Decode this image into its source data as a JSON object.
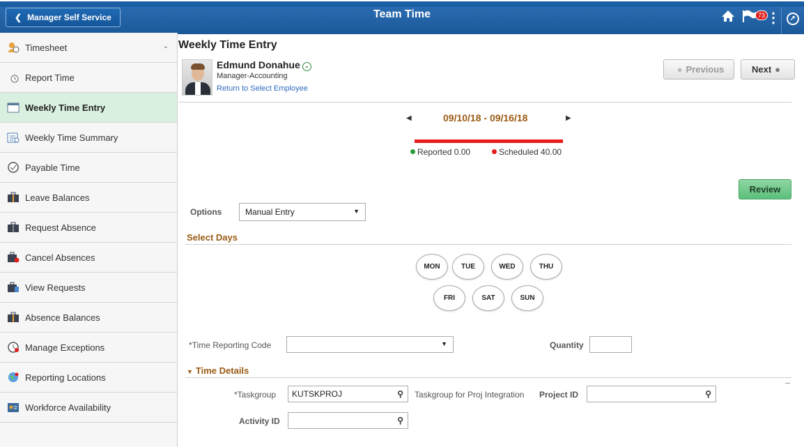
{
  "header": {
    "back_label": "Manager Self Service",
    "title": "Team Time",
    "notification_count": "73"
  },
  "sidebar": {
    "items": [
      {
        "label": "Timesheet",
        "icon": "timesheet-icon"
      },
      {
        "label": "Report Time",
        "icon": "clock-icon"
      },
      {
        "label": "Weekly Time Entry",
        "icon": "calendar-entry-icon"
      },
      {
        "label": "Weekly Time Summary",
        "icon": "calendar-summary-icon"
      },
      {
        "label": "Payable Time",
        "icon": "money-clock-icon"
      },
      {
        "label": "Leave Balances",
        "icon": "suitcase-icon"
      },
      {
        "label": "Request Absence",
        "icon": "suitcase-icon"
      },
      {
        "label": "Cancel Absences",
        "icon": "suitcase-cancel-icon"
      },
      {
        "label": "View Requests",
        "icon": "suitcase-view-icon"
      },
      {
        "label": "Absence Balances",
        "icon": "suitcase-icon"
      },
      {
        "label": "Manage Exceptions",
        "icon": "alert-clock-icon"
      },
      {
        "label": "Reporting Locations",
        "icon": "globe-icon"
      },
      {
        "label": "Workforce Availability",
        "icon": "availability-icon"
      }
    ]
  },
  "main": {
    "page_title": "Weekly Time Entry",
    "employee": {
      "name": "Edmund Donahue",
      "title": "Manager-Accounting",
      "return_link": "Return to Select Employee"
    },
    "previous_label": "Previous",
    "next_label": "Next",
    "week_range": "09/10/18 - 09/16/18",
    "reported": "Reported 0.00",
    "scheduled": "Scheduled 40.00",
    "review_label": "Review",
    "options_label": "Options",
    "options_value": "Manual Entry",
    "select_days_label": "Select Days",
    "days_row1": [
      "MON",
      "TUE",
      "WED",
      "THU"
    ],
    "days_row2": [
      "FRI",
      "SAT",
      "SUN"
    ],
    "trc_label": "*Time Reporting Code",
    "trc_value": "",
    "quantity_label": "Quantity",
    "quantity_value": "",
    "time_details_label": "Time Details",
    "taskgroup_label": "*Taskgroup",
    "taskgroup_value": "KUTSKPROJ",
    "taskgroup_desc": "Taskgroup for Proj Integration",
    "project_id_label": "Project ID",
    "project_id_value": "",
    "activity_id_label": "Activity ID",
    "activity_id_value": ""
  },
  "colors": {
    "header_blue": "#1b5998",
    "active_item_bg": "#d9efdf",
    "accent_brown": "#9a5b14",
    "schedule_red": "#e81b1b",
    "reported_green": "#2a9a3a",
    "review_green": "#5cbf7a"
  }
}
